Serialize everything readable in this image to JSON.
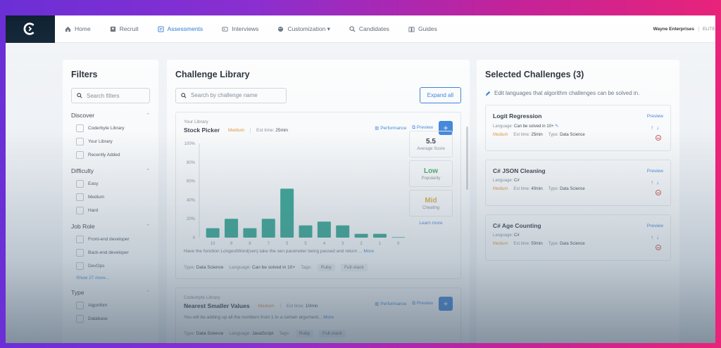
{
  "nav": {
    "items": [
      {
        "label": "Home",
        "icon": "home-icon"
      },
      {
        "label": "Recruit",
        "icon": "recruit-icon"
      },
      {
        "label": "Assessments",
        "icon": "assessments-icon",
        "active": true
      },
      {
        "label": "Interviews",
        "icon": "interviews-icon"
      },
      {
        "label": "Customization ▾",
        "icon": "customization-icon"
      },
      {
        "label": "Candidates",
        "icon": "search-icon"
      },
      {
        "label": "Guides",
        "icon": "book-icon"
      }
    ],
    "company": "Wayne Enterprises",
    "tier": "ELITE"
  },
  "filters": {
    "title": "Filters",
    "search_placeholder": "Search filters",
    "sections": [
      {
        "title": "Discover",
        "options": [
          "Coderbyte Library",
          "Your Library",
          "Recently Added"
        ]
      },
      {
        "title": "Difficulty",
        "options": [
          "Easy",
          "Medium",
          "Hard"
        ]
      },
      {
        "title": "Job Role",
        "options": [
          "Front-end developer",
          "Back-end developer",
          "DevOps"
        ],
        "more": "Show 27 more..."
      },
      {
        "title": "Type",
        "options": [
          "Algorithm",
          "Database"
        ]
      }
    ]
  },
  "library": {
    "title": "Challenge Library",
    "search_placeholder": "Search by challenge name",
    "expand_label": "Expand all",
    "cards": [
      {
        "source": "Your Library",
        "name": "Stock Picker",
        "difficulty": "Medium",
        "est_label": "Est time:",
        "est": "25min",
        "performance": "Performance",
        "preview": "Preview",
        "stats": [
          {
            "value": "5.5",
            "label": "Average Score",
            "color": "#2b3440"
          },
          {
            "value": "Low",
            "label": "Popularity",
            "color": "#3aa05a"
          },
          {
            "value": "Mid",
            "label": "Cheating",
            "color": "#d9a83a"
          }
        ],
        "learn_more": "Learn more",
        "description": "Have the function LongestWord(sen) take the sen parameter being passed and return ...",
        "more": "More",
        "type_label": "Type:",
        "type": "Data Science",
        "language_label": "Language:",
        "language": "Can be solved in 10+",
        "tags_label": "Tags:",
        "tags": [
          "Ruby",
          "Full-stack"
        ]
      },
      {
        "source": "Coderbyte Library",
        "name": "Nearest Smaller Values",
        "difficulty": "Medium",
        "est_label": "Est time:",
        "est": "10min",
        "performance": "Performance",
        "preview": "Preview",
        "description": "You will be adding up all the numbers from 1 to a certain argument...",
        "more": "More",
        "type_label": "Type:",
        "type": "Data Science",
        "language_label": "Language:",
        "language": "JavaScript",
        "tags_label": "Tags:",
        "tags": [
          "Ruby",
          "Full-stack"
        ]
      }
    ]
  },
  "chart_data": {
    "type": "bar",
    "categories": [
      "10",
      "9",
      "8",
      "7",
      "5",
      "5",
      "4",
      "3",
      "2",
      "1",
      "0"
    ],
    "values": [
      10,
      20,
      10,
      20,
      52,
      13,
      17,
      13,
      4,
      4,
      0.5
    ],
    "ylim": [
      0,
      100
    ],
    "yticks": [
      "0",
      "20%",
      "40%",
      "60%",
      "80%",
      "100%"
    ],
    "color": "#1f9e88"
  },
  "selected": {
    "title": "Selected Challenges (3)",
    "subtitle": "Edit languages that algorithm challenges can be solved in.",
    "language_label": "Language:",
    "est_label": "Est time:",
    "type_label": "Type:",
    "preview": "Preview",
    "items": [
      {
        "name": "Logit Regression",
        "language": "Can be solved in 10+",
        "difficulty": "Medium",
        "est": "25min",
        "type": "Data Science"
      },
      {
        "name": "C# JSON Cleaning",
        "language": "C#",
        "difficulty": "Medium",
        "est": "40min",
        "type": "Data Science"
      },
      {
        "name": "C# Age Counting",
        "language": "C#",
        "difficulty": "Medium",
        "est": "50min",
        "type": "Data Science"
      }
    ]
  }
}
